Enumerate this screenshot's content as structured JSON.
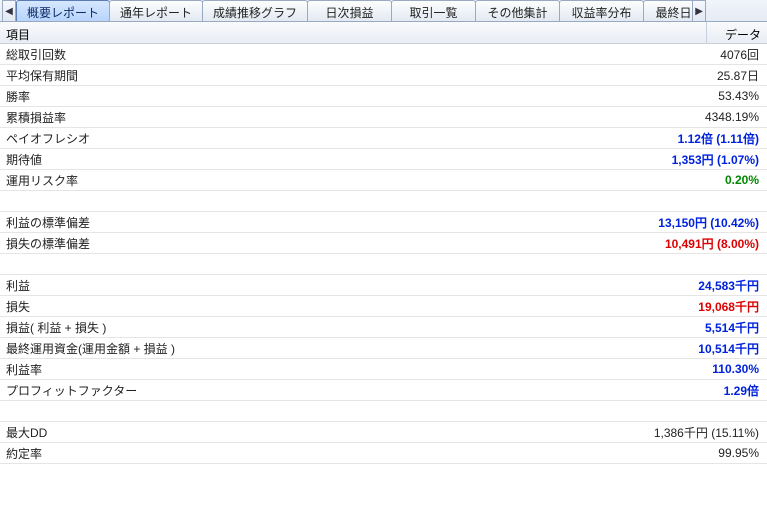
{
  "tabs": {
    "t0": "概要レポート",
    "t1": "通年レポート",
    "t2": "成績推移グラフ",
    "t3": "日次損益",
    "t4": "取引一覧",
    "t5": "その他集計",
    "t6": "収益率分布",
    "t7": "最終日"
  },
  "arrows": {
    "left": "◀",
    "right": "▶"
  },
  "header": {
    "item": "項目",
    "data": "データ"
  },
  "rows": {
    "r0": {
      "label": "総取引回数",
      "value": "4076回"
    },
    "r1": {
      "label": "平均保有期間",
      "value": "25.87日"
    },
    "r2": {
      "label": "勝率",
      "value": "53.43%"
    },
    "r3": {
      "label": "累積損益率",
      "value": "4348.19%"
    },
    "r4": {
      "label": "ペイオフレシオ",
      "value": "1.12倍 (1.11倍)"
    },
    "r5": {
      "label": "期待値",
      "value": "1,353円 (1.07%)"
    },
    "r6": {
      "label": "運用リスク率",
      "value": "0.20%"
    },
    "r7": {
      "label": "利益の標準偏差",
      "value": "13,150円 (10.42%)"
    },
    "r8": {
      "label": "損失の標準偏差",
      "value": "10,491円 (8.00%)"
    },
    "r9": {
      "label": "利益",
      "value": "24,583千円"
    },
    "r10": {
      "label": "損失",
      "value": "19,068千円"
    },
    "r11": {
      "label": "損益( 利益 + 損失 )",
      "value": "5,514千円"
    },
    "r12": {
      "label": "最終運用資金(運用金額 + 損益 )",
      "value": "10,514千円"
    },
    "r13": {
      "label": "利益率",
      "value": "110.30%"
    },
    "r14": {
      "label": "プロフィットファクター",
      "value": "1.29倍"
    },
    "r15": {
      "label": "最大DD",
      "value": "1,386千円 (15.11%)"
    },
    "r16": {
      "label": "約定率",
      "value": "99.95%"
    }
  }
}
